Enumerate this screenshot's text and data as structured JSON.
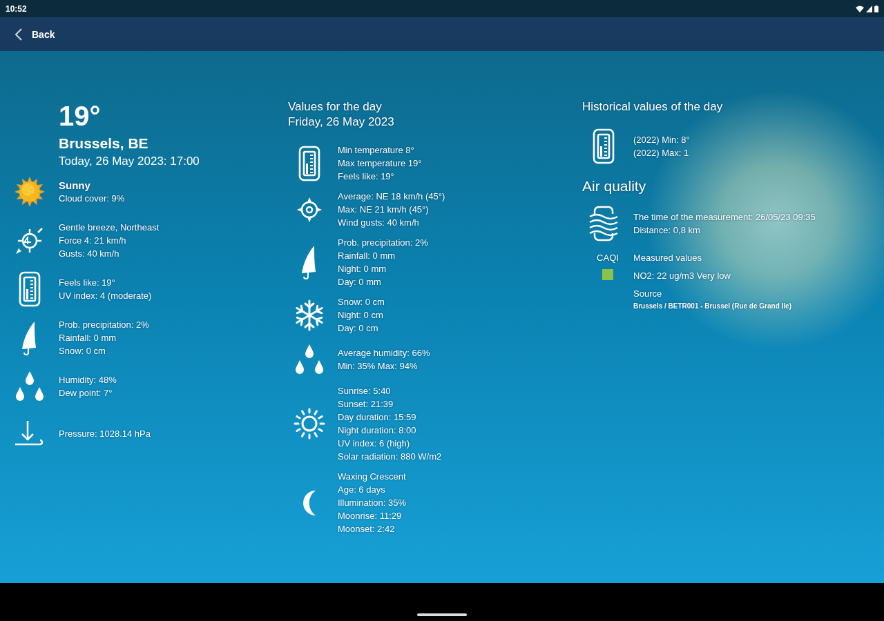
{
  "status_bar": {
    "time": "10:52"
  },
  "app_bar": {
    "back_label": "Back"
  },
  "current": {
    "temperature": "19°",
    "location": "Brussels, BE",
    "datetime": "Today, 26 May 2023: 17:00",
    "items": [
      {
        "kind": "sun",
        "title": "Sunny",
        "lines": [
          "Cloud cover: 9%"
        ]
      },
      {
        "kind": "wind",
        "lines": [
          "Gentle breeze, Northeast",
          "Force 4: 21 km/h",
          "Gusts: 40 km/h"
        ]
      },
      {
        "kind": "thermometer",
        "lines": [
          "Feels like: 19°",
          "UV index: 4 (moderate)"
        ]
      },
      {
        "kind": "umbrella",
        "lines": [
          "Prob. precipitation: 2%",
          "Rainfall: 0 mm",
          "Snow: 0 cm"
        ]
      },
      {
        "kind": "drops",
        "lines": [
          "Humidity: 48%",
          "Dew point: 7°"
        ]
      },
      {
        "kind": "pressure",
        "lines": [
          "Pressure: 1028.14 hPa"
        ]
      }
    ]
  },
  "day": {
    "heading": "Values for the day",
    "date": "Friday, 26 May 2023",
    "items": [
      {
        "kind": "thermometer",
        "lines": [
          "Min temperature 8°",
          "Max temperature 19°",
          "Feels like: 19°"
        ]
      },
      {
        "kind": "compass",
        "lines": [
          "Average: NE 18 km/h (45°)",
          "Max: NE 21 km/h (45°)",
          "Wind gusts: 40 km/h"
        ]
      },
      {
        "kind": "umbrella",
        "lines": [
          "Prob. precipitation: 2%",
          "Rainfall: 0 mm",
          "Night: 0 mm",
          "Day: 0 mm"
        ]
      },
      {
        "kind": "snowflake",
        "lines": [
          "Snow: 0 cm",
          "Night: 0 cm",
          "Day: 0 cm"
        ]
      },
      {
        "kind": "drops",
        "lines": [
          "Average humidity: 66%",
          "Min: 35% Max: 94%"
        ]
      },
      {
        "kind": "sunrise",
        "lines": [
          "Sunrise: 5:40",
          "Sunset: 21:39",
          "Day duration: 15:59",
          "Night duration: 8:00",
          "UV index: 6 (high)",
          "Solar radiation: 880 W/m2"
        ]
      },
      {
        "kind": "moon",
        "lines": [
          "Waxing Crescent",
          "Age: 6 days",
          "Illumination: 35%",
          "Moonrise: 11:29",
          "Moonset: 2:42"
        ]
      }
    ]
  },
  "historical": {
    "heading": "Historical values of the day",
    "items": [
      {
        "kind": "thermometer",
        "lines": [
          "(2022) Min: 8°",
          "(2022) Max: 1"
        ]
      }
    ]
  },
  "air_quality": {
    "heading": "Air quality",
    "items": [
      {
        "kind": "air",
        "lines": [
          "The time of the measurement: 26/05/23 09:35",
          "Distance: 0,8 km"
        ]
      }
    ],
    "index_label": "CAQI",
    "measured_label": "Measured values",
    "measured": [
      {
        "text": "NO2: 22 ug/m3 Very low",
        "color": "#8bc34a"
      }
    ],
    "source_label": "Source",
    "source": "Brussels / BETR001 - Brussel (Rue de Grand Ile)"
  }
}
